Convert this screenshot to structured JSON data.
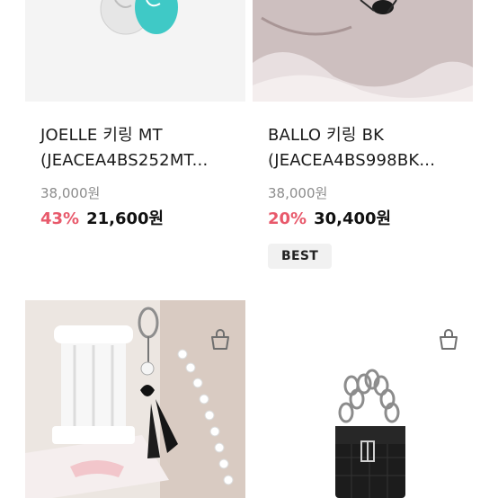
{
  "products": [
    {
      "name_line1": "JOELLE 키링 MT",
      "name_line2": "(JEACEA4BS252MT...",
      "original_price": "38,000원",
      "discount": "43%",
      "sale_price": "21,600원",
      "badge": ""
    },
    {
      "name_line1": "BALLO 키링 BK",
      "name_line2": "(JEACEA4BS998BK...",
      "original_price": "38,000원",
      "discount": "20%",
      "sale_price": "30,400원",
      "badge": "BEST"
    },
    {
      "icon": "shopping-bag-icon"
    },
    {
      "icon": "shopping-bag-icon"
    }
  ],
  "colors": {
    "discount": "#e8596b",
    "original_price": "#8c8c8c",
    "badge_bg": "#f1f1f1"
  }
}
